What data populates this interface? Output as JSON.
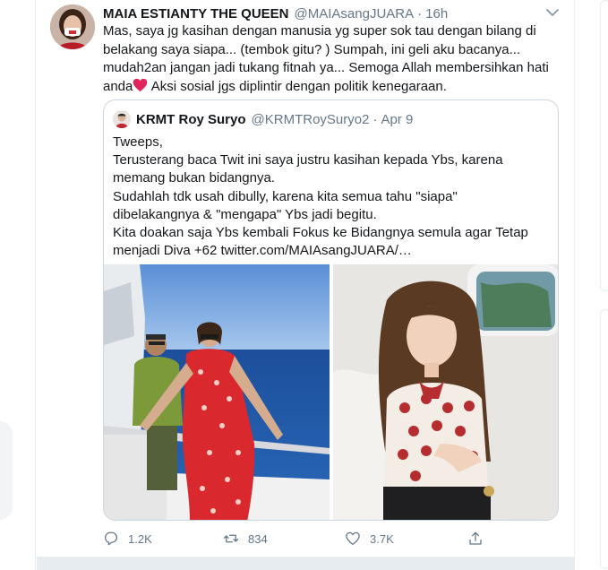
{
  "tweet": {
    "author_name": "MAIA ESTIANTY THE QUEEN",
    "author_handle": "@MAIAsangJUARA",
    "separator": "·",
    "time": "16h",
    "text_before_heart": "Mas, saya jg kasihan dengan manusia yg super sok tau dengan bilang di belakang saya siapa... (tembok gitu? ) Sumpah, ini geli aku bacanya... mudah2an jangan jadi tukang fitnah ya... Semoga Allah membersihkan hati anda",
    "text_after_heart": " Aksi sosial jgs diplintir dengan politik kenegaraan."
  },
  "quote": {
    "author_name": "KRMT Roy Suryo",
    "author_handle": "@KRMTRoySuryo2",
    "separator": "·",
    "date": "Apr 9",
    "lines": [
      "Tweeps,",
      "Terusterang baca Twit ini saya justru kasihan kepada Ybs, karena",
      "memang bukan bidangnya.",
      "Sudahlah tdk usah dibully, karena kita semua tahu \"siapa\"",
      "dibelakangnya & \"mengapa\" Ybs jadi begitu.",
      "Kita doakan saja Ybs kembali Fokus ke Bidangnya semula agar Tetap",
      "menjadi Diva +62 twitter.com/MAIAsangJUARA/…"
    ]
  },
  "actions": {
    "replies": "1.2K",
    "retweets": "834",
    "likes": "3.7K"
  },
  "icons": {
    "caret": "chevron-down-icon",
    "reply": "reply-icon",
    "retweet": "retweet-icon",
    "like": "heart-icon",
    "share": "share-icon",
    "inline_heart": "red-heart-emoji"
  },
  "colors": {
    "text": "#14171a",
    "secondary": "#657786",
    "border": "#ccd6dd",
    "divider": "#e6ecf0",
    "heart": "#e0245e"
  }
}
